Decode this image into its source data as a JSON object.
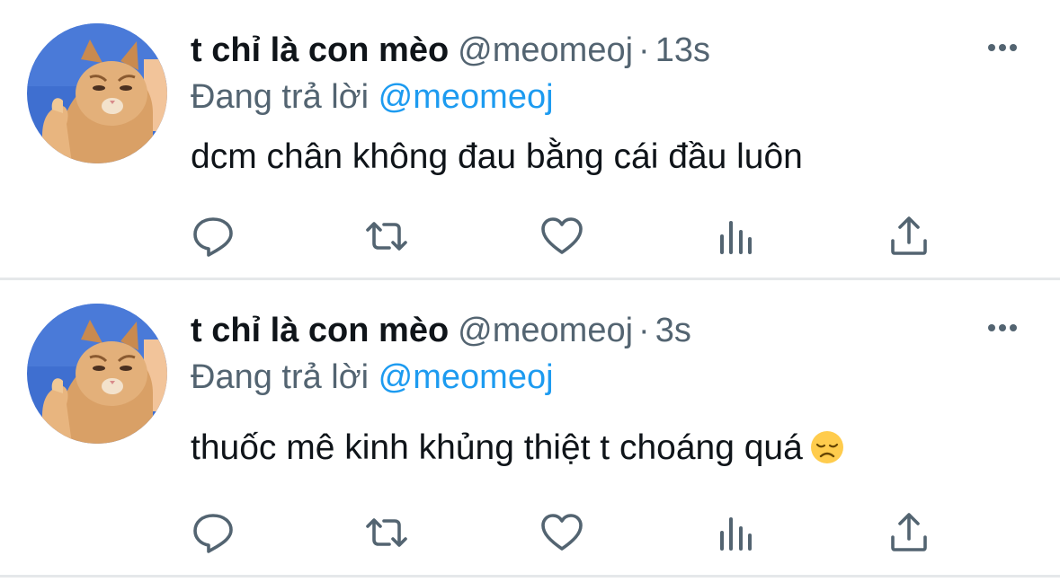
{
  "tweets": [
    {
      "display_name": "t chỉ là con mèo",
      "handle": "@meomeoj",
      "separator": "·",
      "time": "13s",
      "reply_prefix": "Đang trả lời",
      "reply_to": "@meomeoj",
      "text": "dcm chân không đau bằng cái đầu luôn",
      "emoji": null
    },
    {
      "display_name": "t chỉ là con mèo",
      "handle": "@meomeoj",
      "separator": "·",
      "time": "3s",
      "reply_prefix": "Đang trả lời",
      "reply_to": "@meomeoj",
      "text": "thuốc mê kinh khủng thiệt t choáng quá",
      "emoji": "disappointed-face-emoji"
    }
  ],
  "icons": {
    "more": "more-horizontal-icon",
    "reply": "reply-icon",
    "retweet": "retweet-icon",
    "like": "heart-icon",
    "stats": "bar-chart-icon",
    "share": "share-icon"
  },
  "colors": {
    "name": "#0f1419",
    "secondary": "#536471",
    "mention": "#1d9bf0",
    "icon": "#536471",
    "divider": "#e5e8ea"
  }
}
